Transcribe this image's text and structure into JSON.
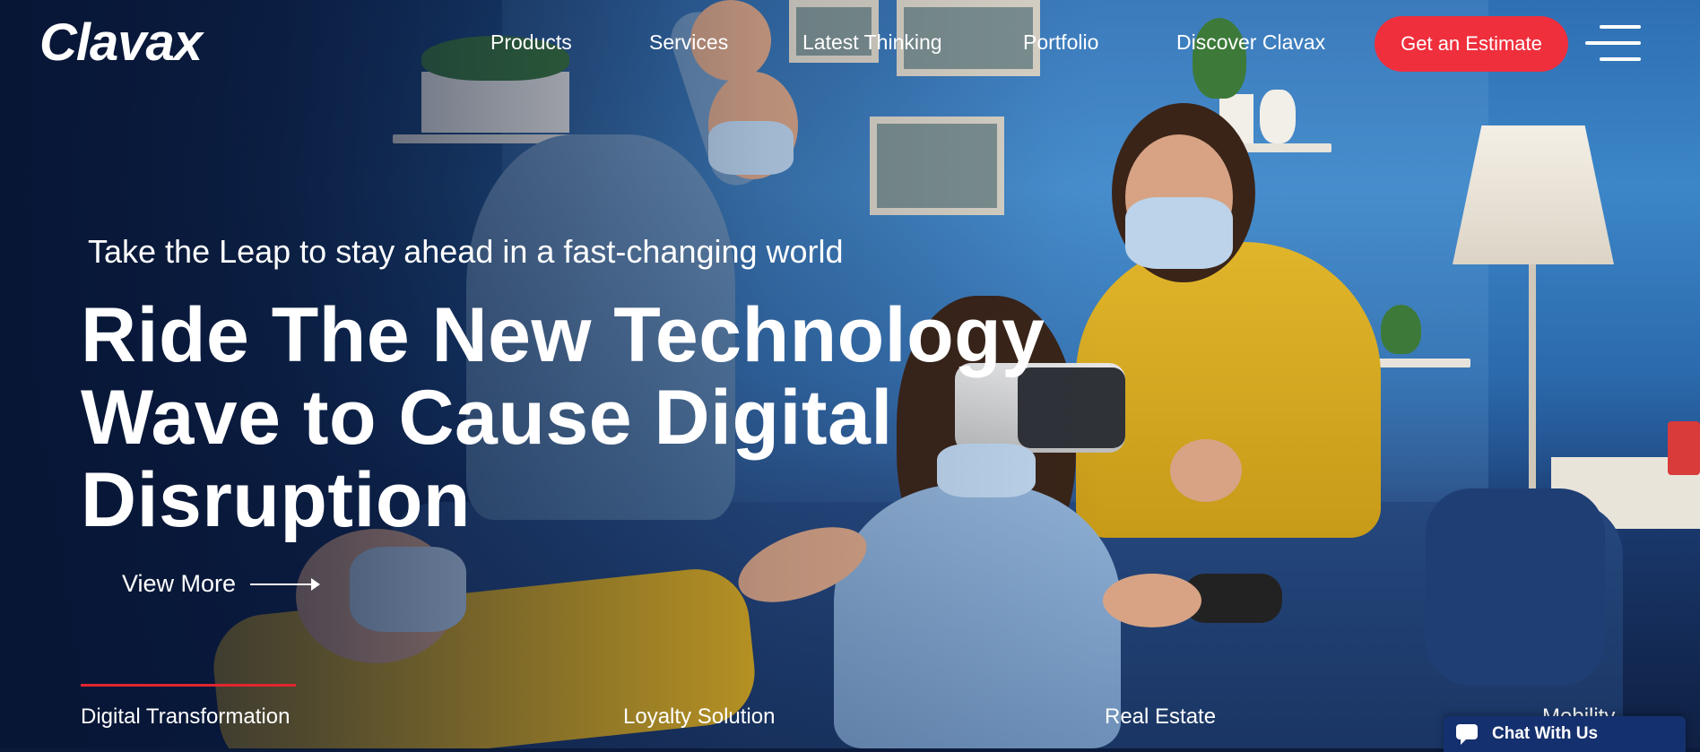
{
  "brand": {
    "logo_text": "Clavax"
  },
  "nav": {
    "items": [
      {
        "label": "Products"
      },
      {
        "label": "Services"
      },
      {
        "label": "Latest Thinking"
      },
      {
        "label": "Portfolio"
      },
      {
        "label": "Discover Clavax"
      }
    ],
    "cta_label": "Get an Estimate",
    "menu_icon": "hamburger-icon"
  },
  "hero": {
    "tagline": "Take the Leap to stay ahead in a fast-changing world",
    "headline_lines": [
      "Ride The New Technology",
      "Wave to Cause Digital",
      "Disruption"
    ],
    "view_more_label": "View More"
  },
  "tabs": {
    "items": [
      {
        "label": "Digital Transformation",
        "active": true
      },
      {
        "label": "Loyalty Solution",
        "active": false
      },
      {
        "label": "Real Estate",
        "active": false
      },
      {
        "label": "Mobility",
        "active": false
      }
    ]
  },
  "chat": {
    "label": "Chat With Us",
    "icon": "chat-bubble-icon"
  },
  "colors": {
    "accent": "#ef2f3c",
    "tab_indicator": "#e2262f",
    "chat_bg": "#15306e",
    "overlay": "#0b1a3a"
  }
}
